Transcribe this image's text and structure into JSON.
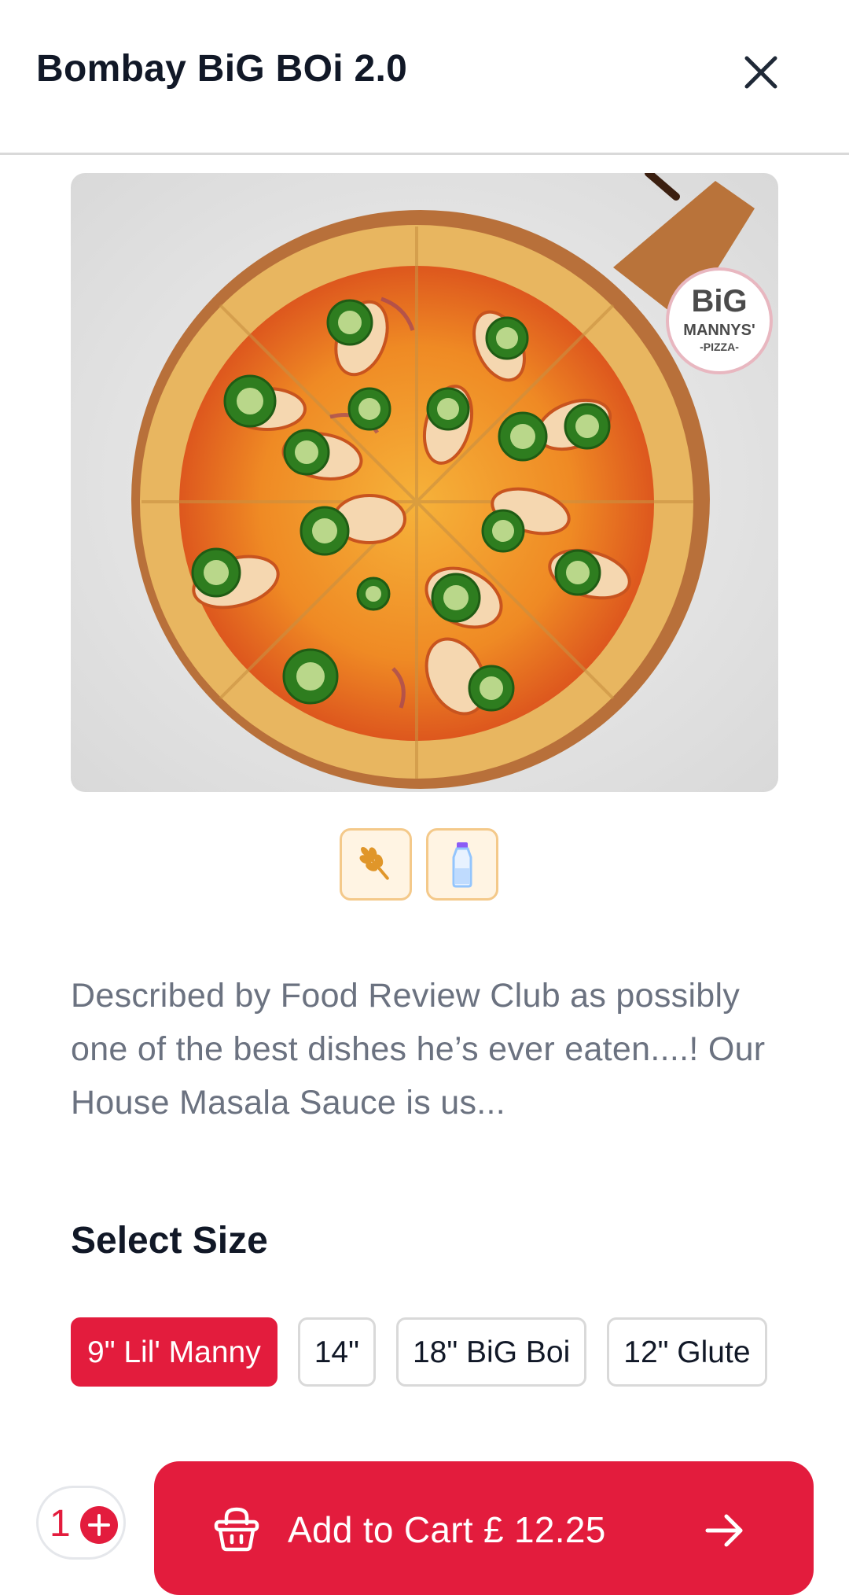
{
  "header": {
    "title": "Bombay BiG BOi 2.0"
  },
  "hero": {
    "logo_lines": [
      "BiG",
      "MANNYS'",
      "-PIZZA-"
    ]
  },
  "badges": [
    {
      "icon": "wheat-icon"
    },
    {
      "icon": "milk-bottle-icon"
    }
  ],
  "description": "Described by Food Review Club as possibly one of the best dishes he’s ever eaten....! Our House Masala Sauce is us...",
  "size_section": {
    "title": "Select Size",
    "options": [
      "9\" Lil' Manny",
      "14\"",
      "18\" BiG Boi",
      "12\" Glute"
    ],
    "selected": "9\" Lil' Manny"
  },
  "bottom_bar": {
    "quantity": "1",
    "add_to_cart_label": "Add to Cart £ 12.25"
  },
  "colors": {
    "accent": "#e31c3d",
    "badge_border": "#f4c98a",
    "badge_bg": "#fff4e3",
    "text_muted": "#6b7280"
  }
}
